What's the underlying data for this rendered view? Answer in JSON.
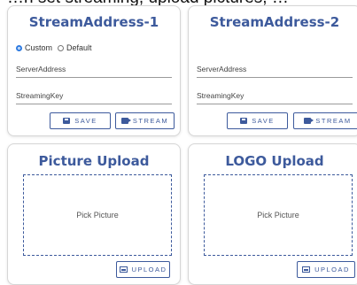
{
  "cropped_header": {
    "text": "…n set streaming, upload pictures, …"
  },
  "stream_cards": [
    {
      "title": "StreamAddress-1",
      "radio_custom": "Custom",
      "radio_default": "Default",
      "server_label": "ServerAddress",
      "key_label": "StreamingKey",
      "save_label": "SAVE",
      "stream_label": "STREAM"
    },
    {
      "title": "StreamAddress-2",
      "server_label": "ServerAddress",
      "key_label": "StreamingKey",
      "save_label": "SAVE",
      "stream_label": "STREAM"
    }
  ],
  "upload_cards": [
    {
      "title": "Picture Upload",
      "placeholder": "Pick Picture",
      "upload_label": "UPLOAD"
    },
    {
      "title": "LOGO Upload",
      "placeholder": "Pick Picture",
      "upload_label": "UPLOAD"
    }
  ],
  "colors": {
    "accent": "#3d5a9c",
    "radio": "#2f7be0"
  }
}
